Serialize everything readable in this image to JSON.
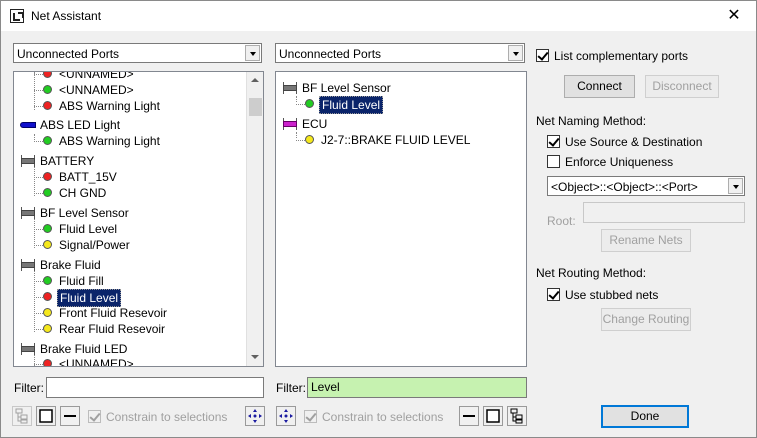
{
  "window": {
    "title": "Net Assistant",
    "close_glyph": "✕"
  },
  "left_panel": {
    "filter_dropdown": "Unconnected Ports",
    "tree": [
      {
        "type": "port",
        "color": "red",
        "label": "<UNNAMED>"
      },
      {
        "type": "port",
        "color": "green",
        "label": "<UNNAMED>"
      },
      {
        "type": "port",
        "color": "red",
        "label": "ABS Warning Light"
      },
      {
        "type": "component",
        "icon": "led-icon",
        "label": "ABS LED Light"
      },
      {
        "type": "port",
        "color": "green",
        "label": "ABS Warning Light"
      },
      {
        "type": "component",
        "icon": "chip-icon",
        "label": "BATTERY"
      },
      {
        "type": "port",
        "color": "red",
        "label": "BATT_15V"
      },
      {
        "type": "port",
        "color": "green",
        "label": "CH GND"
      },
      {
        "type": "component",
        "icon": "chip-icon",
        "label": "BF Level Sensor"
      },
      {
        "type": "port",
        "color": "green",
        "label": "Fluid Level"
      },
      {
        "type": "port",
        "color": "yellow",
        "label": "Signal/Power"
      },
      {
        "type": "component",
        "icon": "chip-icon",
        "label": "Brake Fluid"
      },
      {
        "type": "port",
        "color": "green",
        "label": "Fluid Fill"
      },
      {
        "type": "port",
        "color": "red",
        "label": "Fluid Level",
        "selected": true
      },
      {
        "type": "port",
        "color": "yellow",
        "label": "Front Fluid Resevoir"
      },
      {
        "type": "port",
        "color": "yellow",
        "label": "Rear Fluid Resevoir"
      },
      {
        "type": "component",
        "icon": "chip-icon",
        "label": "Brake Fluid LED"
      },
      {
        "type": "port",
        "color": "red",
        "label": "<UNNAMED>"
      }
    ],
    "filter_label": "Filter:",
    "filter_value": "",
    "constrain_label": "Constrain to selections"
  },
  "middle_panel": {
    "filter_dropdown": "Unconnected Ports",
    "tree": [
      {
        "type": "component",
        "icon": "chip-icon",
        "label": "BF Level Sensor"
      },
      {
        "type": "port",
        "color": "green",
        "label": "Fluid Level",
        "selected": true
      },
      {
        "type": "component",
        "icon": "magenta-chip-icon",
        "label": "ECU"
      },
      {
        "type": "port",
        "color": "yellow",
        "label": "J2-7::BRAKE FLUID LEVEL"
      }
    ],
    "filter_label": "Filter:",
    "filter_value": "Level",
    "constrain_label": "Constrain to selections"
  },
  "right_panel": {
    "list_complementary_label": "List complementary ports",
    "connect_label": "Connect",
    "disconnect_label": "Disconnect",
    "naming_heading": "Net Naming Method:",
    "use_source_dest_label": "Use Source & Destination",
    "enforce_uniqueness_label": "Enforce Uniqueness",
    "naming_pattern": "<Object>::<Object>::<Port>",
    "root_label": "Root:",
    "root_value": "",
    "rename_nets_label": "Rename Nets",
    "routing_heading": "Net Routing Method:",
    "use_stubbed_label": "Use stubbed nets",
    "change_routing_label": "Change Routing",
    "done_label": "Done"
  },
  "colors": {
    "selection": "#0a246a",
    "filter_highlight": "#c6f2b0",
    "port_green": "#22cc22",
    "port_red": "#ee2222",
    "port_yellow": "#f5e81c",
    "ecu_magenta": "#cc22cc",
    "led_blue": "#1010cc"
  }
}
